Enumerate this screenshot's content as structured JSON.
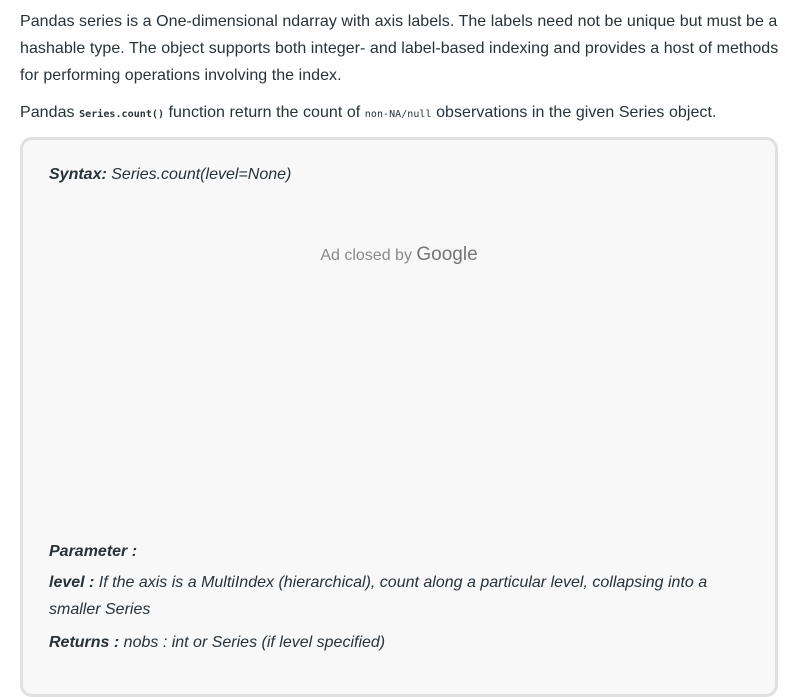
{
  "article": {
    "para1": "Pandas series is a One-dimensional ndarray with axis labels. The labels need not be unique but must be a hashable type. The object supports both integer- and label-based indexing and provides a host of methods for performing operations involving the index.",
    "para2_prefix": "Pandas ",
    "para2_code1": "Series.count()",
    "para2_middle": " function return the count of ",
    "para2_code2": "non-NA/null",
    "para2_suffix": " observations in the given Series object."
  },
  "box": {
    "syntax_label": "Syntax:",
    "syntax_value": " Series.count(level=None)",
    "ad_text": "Ad closed by ",
    "ad_brand": "Google",
    "parameter_label": "Parameter :",
    "level_label": "level :",
    "level_desc": " If the axis is a MultiIndex (hierarchical), count along a particular level, collapsing into a smaller Series",
    "returns_label": "Returns :",
    "returns_value": " nobs : int or Series (if level specified)"
  }
}
